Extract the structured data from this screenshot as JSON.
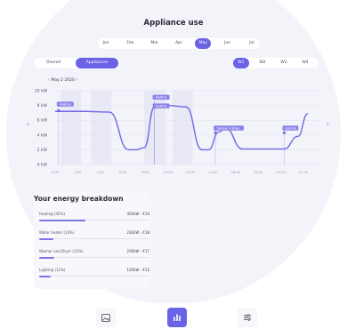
{
  "page": {
    "title": "Appliance use"
  },
  "months": [
    "Jan",
    "Feb",
    "Mar",
    "Apr",
    "May",
    "Jun",
    "Jul"
  ],
  "selected_month": "May",
  "view_tabs": {
    "overall": "Overall",
    "appliances": "Appliances",
    "selected": "Appliances"
  },
  "weeks": [
    "W1",
    "W2",
    "W3",
    "W4"
  ],
  "selected_week": "W1",
  "date_nav": {
    "prev": "‹",
    "label": "May 2 2020",
    "next": "›"
  },
  "chart_data": {
    "type": "line",
    "y_ticks": [
      "10 kW",
      "8 kW",
      "6 kW",
      "4 kW",
      "2 kW",
      "0 kW"
    ],
    "ylim": [
      0,
      10
    ],
    "x_ticks": [
      "0:00",
      "2:00",
      "4:00",
      "6:00",
      "8:00",
      "10:00",
      "12:00",
      "14:00",
      "16:00",
      "18:00",
      "20:00",
      "22:00"
    ],
    "series": [
      {
        "color": "#7468e6",
        "x": [
          0,
          2.5,
          4.8,
          6.5,
          7.2,
          7.9,
          8.8,
          10,
          11.6,
          13,
          13.6,
          14.5,
          15.1,
          16.6,
          18.5,
          20.3,
          21.5,
          22.4
        ],
        "y": [
          7.2,
          7.2,
          7.1,
          2.0,
          2.0,
          2.3,
          7.8,
          8.0,
          7.8,
          2.0,
          2.0,
          4.4,
          4.9,
          2.1,
          2.1,
          2.1,
          3.8,
          6.9
        ]
      }
    ],
    "annotations": [
      {
        "label": "Heating",
        "x": 0.3,
        "y": 7.3
      },
      {
        "label": "Heating",
        "x": 8.8,
        "y": 8.0
      },
      {
        "label": "Heating",
        "x": 8.8,
        "y": 7.9
      },
      {
        "label": "Washer & Dryer",
        "x": 14.2,
        "y": 4.3
      },
      {
        "label": "Lighting",
        "x": 20.3,
        "y": 4.3
      }
    ],
    "bands": [
      {
        "from": 0.5,
        "to": 2.3
      },
      {
        "from": 3.2,
        "to": 5.0
      },
      {
        "from": 7.9,
        "to": 9.8
      },
      {
        "from": 10.4,
        "to": 12.2
      }
    ]
  },
  "breakdown": {
    "title": "Your energy breakdown",
    "items": [
      {
        "name": "Heating (45%)",
        "value": "450kW - €34",
        "pct": 45
      },
      {
        "name": "Water heater (14%)",
        "value": "230kW - €18",
        "pct": 14
      },
      {
        "name": "Washer and Dryer (15%)",
        "value": "230kW - €17",
        "pct": 15
      },
      {
        "name": "Lighting (11%)",
        "value": "120kW - €12",
        "pct": 11
      }
    ]
  },
  "bottom_nav": [
    {
      "icon": "image-icon",
      "active": false
    },
    {
      "icon": "bar-chart-icon",
      "active": true
    },
    {
      "icon": "sliders-icon",
      "active": false
    }
  ],
  "colors": {
    "accent": "#6b63e6",
    "line": "#7468e6",
    "background": "#f3f3fa"
  }
}
